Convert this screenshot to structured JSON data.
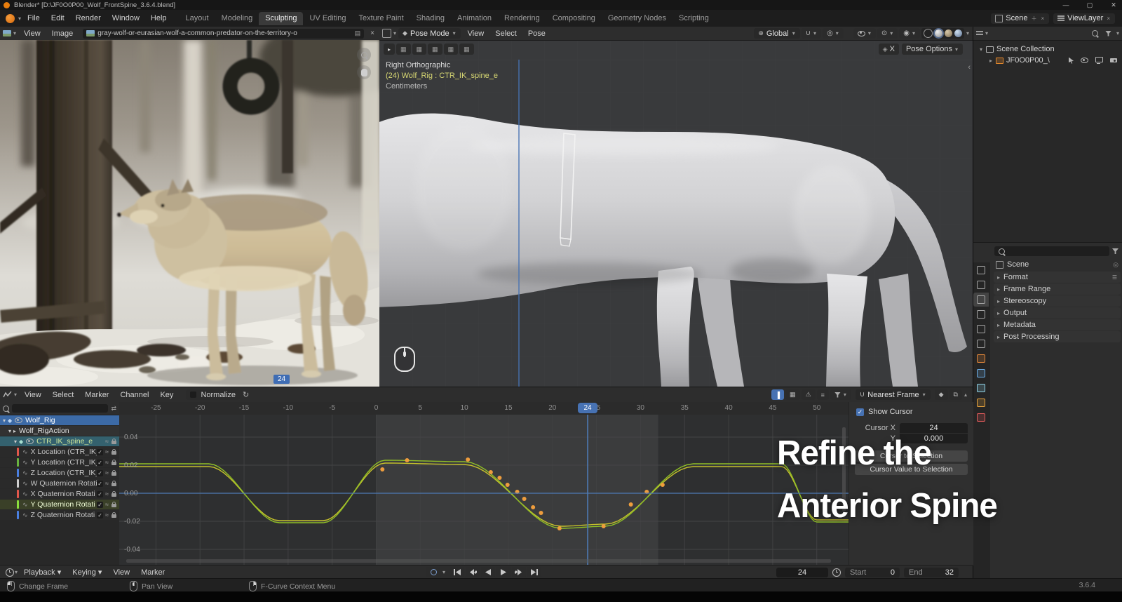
{
  "window": {
    "title": "Blender*  [D:\\JF0O0P00_Wolf_FrontSpine_3.6.4.blend]"
  },
  "topbar": {
    "menus": [
      "File",
      "Edit",
      "Render",
      "Window",
      "Help"
    ],
    "workspaces": [
      "Layout",
      "Modeling",
      "Sculpting",
      "UV Editing",
      "Texture Paint",
      "Shading",
      "Animation",
      "Rendering",
      "Compositing",
      "Geometry Nodes",
      "Scripting"
    ],
    "active_workspace": "Sculpting",
    "scene_label": "Scene",
    "viewlayer_label": "ViewLayer"
  },
  "image_editor": {
    "menus": [
      "View",
      "Image"
    ],
    "image_name": "gray-wolf-or-eurasian-wolf-a-common-predator-on-the-territory-o",
    "frame_badge": "24"
  },
  "viewport": {
    "mode": "Pose Mode",
    "menus": [
      "View",
      "Select",
      "Pose"
    ],
    "orientation": "Global",
    "mirror_label": "X",
    "pose_options_label": "Pose Options",
    "overlay": {
      "line1": "Right Orthographic",
      "line2": "(24) Wolf_Rig : CTR_IK_spine_e",
      "line3": "Centimeters"
    }
  },
  "outliner": {
    "root_label": "Scene Collection",
    "child_label": "JF0O0P00_\\"
  },
  "properties": {
    "breadcrumb": "Scene",
    "panels": [
      "Format",
      "Frame Range",
      "Stereoscopy",
      "Output",
      "Metadata",
      "Post Processing"
    ],
    "tabs": [
      {
        "name": "tool"
      },
      {
        "name": "render"
      },
      {
        "name": "output",
        "active": true
      },
      {
        "name": "view-layer"
      },
      {
        "name": "scene"
      },
      {
        "name": "world"
      },
      {
        "name": "object",
        "color": "#e2873a"
      },
      {
        "name": "modifiers",
        "color": "#6caee8"
      },
      {
        "name": "particles",
        "color": "#8fd3e8"
      },
      {
        "name": "physics",
        "color": "#e8a33c"
      },
      {
        "name": "texture",
        "color": "#e05a5a"
      }
    ]
  },
  "graph_editor": {
    "menus": [
      "View",
      "Select",
      "Marker",
      "Channel",
      "Key"
    ],
    "normalize_label": "Normalize",
    "snap_label": "Nearest Frame",
    "channels": [
      {
        "label": "Wolf_Rig",
        "kind": "object"
      },
      {
        "label": "Wolf_RigAction",
        "kind": "action"
      },
      {
        "label": "CTR_IK_spine_e",
        "kind": "bone"
      },
      {
        "label": "X Location (CTR_IK_",
        "kind": "fcurve",
        "color": "#e2574c"
      },
      {
        "label": "Y Location (CTR_IK_",
        "kind": "fcurve",
        "color": "#69b340"
      },
      {
        "label": "Z Location (CTR_IK_",
        "kind": "fcurve",
        "color": "#4a7fe0"
      },
      {
        "label": "W Quaternion Rotati",
        "kind": "fcurve",
        "color": "#cfcfcf"
      },
      {
        "label": "X Quaternion Rotati",
        "kind": "fcurve",
        "color": "#e2574c"
      },
      {
        "label": "Y Quaternion Rotati",
        "kind": "fcurve",
        "color": "#8ae03c",
        "selected": true
      },
      {
        "label": "Z Quaternion Rotati",
        "kind": "fcurve",
        "color": "#4a7fe0"
      }
    ],
    "x_ticks": [
      -25,
      -20,
      -15,
      -10,
      -5,
      0,
      5,
      10,
      15,
      20,
      25,
      30,
      35,
      40,
      45,
      50
    ],
    "y_ticks": [
      0.04,
      0.02,
      0.0,
      -0.02,
      -0.04
    ],
    "playhead_frame": "24",
    "frame_range": {
      "start": 0,
      "end": 32
    },
    "cursor_value": 0.0,
    "curves": [
      {
        "color": "#c6c22b",
        "keys": [
          [
            -30,
            0.019
          ],
          [
            -19,
            0.019
          ],
          [
            -11,
            -0.0195
          ],
          [
            -6,
            -0.0195
          ],
          [
            1,
            0.0215
          ],
          [
            10,
            0.0205
          ],
          [
            21,
            -0.0235
          ],
          [
            26,
            -0.022
          ],
          [
            36,
            0.019
          ],
          [
            46,
            0.019
          ],
          [
            50,
            -0.019
          ],
          [
            54,
            -0.019
          ]
        ]
      },
      {
        "color": "#8fbf26",
        "keys": [
          [
            -30,
            0.021
          ],
          [
            -19,
            0.021
          ],
          [
            -11,
            -0.021
          ],
          [
            -6,
            -0.021
          ],
          [
            1,
            0.0235
          ],
          [
            10,
            0.0225
          ],
          [
            21,
            -0.025
          ],
          [
            26,
            -0.0235
          ],
          [
            36,
            0.021
          ],
          [
            46,
            0.021
          ],
          [
            50,
            -0.0205
          ],
          [
            54,
            -0.0205
          ]
        ]
      }
    ],
    "keyframes": [
      [
        0.7,
        0.017
      ],
      [
        3.5,
        0.0235
      ],
      [
        10.4,
        0.024
      ],
      [
        13,
        0.015
      ],
      [
        14,
        0.011
      ],
      [
        14.9,
        0.006
      ],
      [
        16,
        0.001
      ],
      [
        16.8,
        -0.004
      ],
      [
        17.8,
        -0.01
      ],
      [
        18.7,
        -0.014
      ],
      [
        20.8,
        -0.025
      ],
      [
        25.8,
        -0.0235
      ],
      [
        28.9,
        -0.008
      ],
      [
        30.7,
        0.001
      ],
      [
        32.5,
        0.006
      ]
    ],
    "sidebar": {
      "show_cursor": "Show Cursor",
      "cursor_x_label": "Cursor X",
      "cursor_x_value": "24",
      "cursor_y_label": "Y",
      "cursor_y_value": "0.000",
      "buttons": [
        "Cursor to Selection",
        "Cursor Value to Selection"
      ]
    }
  },
  "timeline": {
    "menus": [
      "Playback",
      "Keying",
      "View",
      "Marker"
    ],
    "current_frame": "24",
    "start_label": "Start",
    "start_value": "0",
    "end_label": "End",
    "end_value": "32"
  },
  "statusbar": {
    "items": [
      {
        "icon": "mouse-left",
        "label": "Change Frame"
      },
      {
        "icon": "mouse-middle",
        "label": "Pan View"
      },
      {
        "icon": "mouse-right",
        "label": "F-Curve Context Menu"
      }
    ],
    "version": "3.6.4"
  },
  "overlay_text": {
    "line1": "Refine the",
    "line2": "Anterior Spine"
  },
  "icons": {
    "search-icon": "css-circle-tail",
    "funnel-icon": "css-funnel",
    "chevron-down-icon": "▾",
    "chevron-right-icon": "▸",
    "close-icon": "×",
    "check-icon": "✓",
    "refresh-icon": "↻",
    "eye-icon": "css-eye",
    "lock-icon": "css-lock",
    "camera-icon": "css-camera",
    "monitor-icon": "css-monitor",
    "pointer-icon": "css-pointer",
    "clock-icon": "css-clock",
    "mouse-left-icon": "css-mouse",
    "mouse-middle-icon": "css-mouse",
    "mouse-right-icon": "css-mouse"
  }
}
